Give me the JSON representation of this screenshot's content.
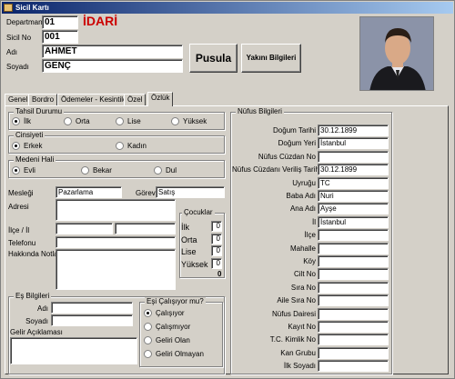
{
  "window": {
    "title": "Sicil Kartı"
  },
  "header": {
    "departman_label": "Departman",
    "departman_value": "01",
    "departman_name": "İDARİ",
    "sicilno_label": "Sicil No",
    "sicilno_value": "001",
    "adi_label": "Adı",
    "adi_value": "AHMET",
    "soyadi_label": "Soyadı",
    "soyadi_value": "GENÇ",
    "pusula_button": "Pusula",
    "yakini_button": "Yakını Bilgileri",
    "name_color": "#cc0000"
  },
  "tabs": [
    "Genel",
    "Bordro",
    "Ödemeler - Kesintiler",
    "Özel",
    "Özlük"
  ],
  "tahsil": {
    "title": "Tahsil Durumu",
    "options": [
      {
        "label": "İlk",
        "selected": true
      },
      {
        "label": "Orta",
        "selected": false
      },
      {
        "label": "Lise",
        "selected": false
      },
      {
        "label": "Yüksek",
        "selected": false
      }
    ]
  },
  "cinsiyet": {
    "title": "Cinsiyeti",
    "options": [
      {
        "label": "Erkek",
        "selected": true
      },
      {
        "label": "Kadın",
        "selected": false
      }
    ]
  },
  "medeni": {
    "title": "Medeni Hali",
    "options": [
      {
        "label": "Evli",
        "selected": true
      },
      {
        "label": "Bekar",
        "selected": false
      },
      {
        "label": "Dul",
        "selected": false
      }
    ]
  },
  "personal": {
    "meslegi_label": "Mesleği",
    "meslegi_value": "Pazarlama",
    "gorevi_label": "Görevi",
    "gorevi_value": "Satış",
    "adresi_label": "Adresi",
    "ilce_label": "İlçe / İl",
    "telefonu_label": "Telefonu",
    "notlar_label": "Hakkında Notlar"
  },
  "cocuklar": {
    "title": "Çocuklar",
    "rows": [
      {
        "label": "İlk",
        "value": "0"
      },
      {
        "label": "Orta",
        "value": "0"
      },
      {
        "label": "Lise",
        "value": "0"
      },
      {
        "label": "Yüksek",
        "value": "0"
      }
    ],
    "total": "0"
  },
  "es": {
    "title": "Eş Bilgileri",
    "adi_label": "Adı",
    "soyadi_label": "Soyadı",
    "gelir_label": "Gelir Açıklaması"
  },
  "es_calisiyor": {
    "title": "Eşi Çalışıyor mu?",
    "options": [
      {
        "label": "Çalışıyor",
        "selected": true
      },
      {
        "label": "Çalışmıyor",
        "selected": false
      },
      {
        "label": "Geliri Olan",
        "selected": false
      },
      {
        "label": "Geliri Olmayan",
        "selected": false
      }
    ]
  },
  "nufus": {
    "title": "Nüfus Bilgileri",
    "fields": [
      {
        "label": "Doğum Tarihi",
        "value": "30.12.1899"
      },
      {
        "label": "Doğum Yeri",
        "value": "İstanbul"
      },
      {
        "label": "Nüfus Cüzdan No",
        "value": ""
      },
      {
        "label": "Nüfus Cüzdanı Veriliş Tarihi",
        "value": "30.12.1899"
      },
      {
        "label": "Uyruğu",
        "value": "TC"
      },
      {
        "label": "Baba Adı",
        "value": "Nuri"
      },
      {
        "label": "Ana Adı",
        "value": "Ayşe"
      },
      {
        "label": "İl",
        "value": "İstanbul"
      },
      {
        "label": "İlçe",
        "value": ""
      },
      {
        "label": "Mahalle",
        "value": ""
      },
      {
        "label": "Köy",
        "value": ""
      },
      {
        "label": "Cilt No",
        "value": ""
      },
      {
        "label": "Sıra No",
        "value": ""
      },
      {
        "label": "Aile Sıra No",
        "value": ""
      },
      {
        "label": "Nüfus Dairesi",
        "value": ""
      },
      {
        "label": "Kayıt No",
        "value": ""
      },
      {
        "label": "T.C. Kimlik No",
        "value": ""
      },
      {
        "label": "Kan Grubu",
        "value": ""
      },
      {
        "label": "İlk Soyadı",
        "value": ""
      }
    ]
  }
}
